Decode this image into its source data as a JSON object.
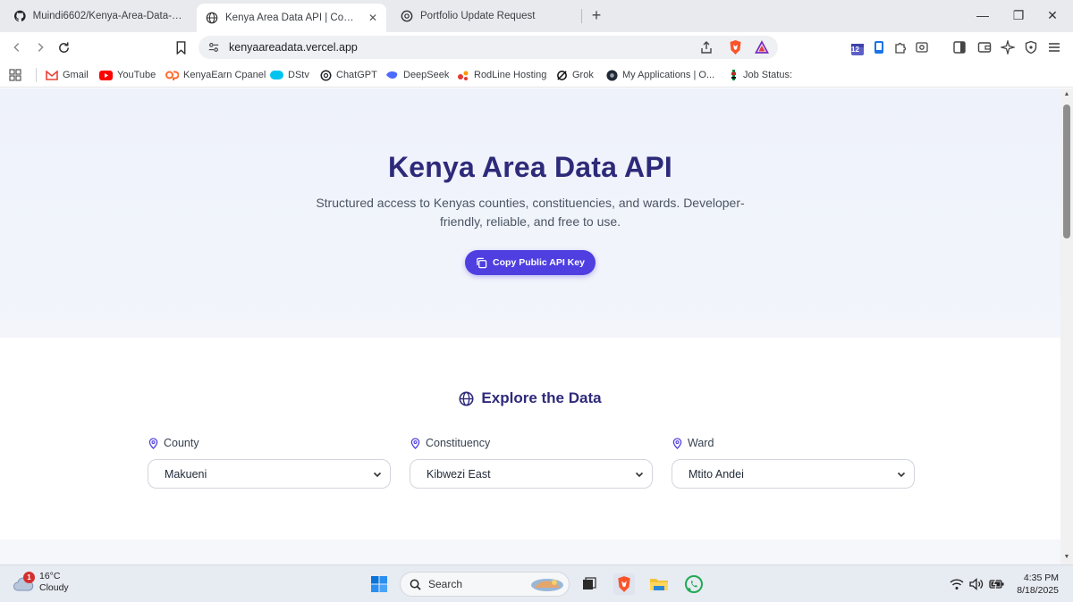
{
  "tabs": [
    {
      "title": "Muindi6602/Kenya-Area-Data-API: K",
      "icon": "github-icon"
    },
    {
      "title": "Kenya Area Data API | Counties, C",
      "icon": "globe-icon"
    },
    {
      "title": "Portfolio Update Request",
      "icon": "chatgpt-icon"
    }
  ],
  "new_tab_label": "+",
  "window_controls": {
    "minimize": "—",
    "restore": "❐",
    "close": "✕"
  },
  "address_bar": {
    "url": "kenyaareadata.vercel.app"
  },
  "extensions": {
    "badge_count": "12"
  },
  "bookmarks": [
    {
      "label": "Gmail",
      "icon": "gmail-icon",
      "color": "#ea4335"
    },
    {
      "label": "YouTube",
      "icon": "youtube-icon",
      "color": "#ff0000"
    },
    {
      "label": "KenyaEarn Cpanel",
      "icon": "cpanel-icon",
      "color": "#ff6c2c"
    },
    {
      "label": "DStv",
      "icon": "dstv-icon",
      "color": "#00c4f0"
    },
    {
      "label": "ChatGPT",
      "icon": "chatgpt-icon",
      "color": "#202123"
    },
    {
      "label": "DeepSeek",
      "icon": "deepseek-icon",
      "color": "#4d6bfe"
    },
    {
      "label": "RodLine Hosting",
      "icon": "rodline-icon",
      "color": "#e53935"
    },
    {
      "label": "Grok",
      "icon": "grok-icon",
      "color": "#111111"
    },
    {
      "label": "My Applications | O...",
      "icon": "applications-icon",
      "color": "#1f2937"
    },
    {
      "label": "Job Status:",
      "icon": "job-status-icon",
      "color": "#1b7f3a"
    }
  ],
  "hero": {
    "title": "Kenya Area Data API",
    "subtitle_line1": "Structured access to Kenyas counties, constituencies, and wards. Developer-",
    "subtitle_line2": "friendly, reliable, and free to use.",
    "api_button_label": "Copy Public API Key"
  },
  "explore": {
    "title": "Explore the Data",
    "county_label": "County",
    "county_value": "Makueni",
    "constituency_label": "Constituency",
    "constituency_value": "Kibwezi East",
    "ward_label": "Ward",
    "ward_value": "Mtito Andei"
  },
  "taskbar": {
    "weather_temp": "16°C",
    "weather_desc": "Cloudy",
    "weather_badge": "1",
    "search_placeholder": "Search",
    "time": "4:35 PM",
    "date": "8/18/2025"
  },
  "colors": {
    "accent": "#4f3fe0",
    "heading": "#2e2a7a",
    "brave": "#fb542b"
  }
}
